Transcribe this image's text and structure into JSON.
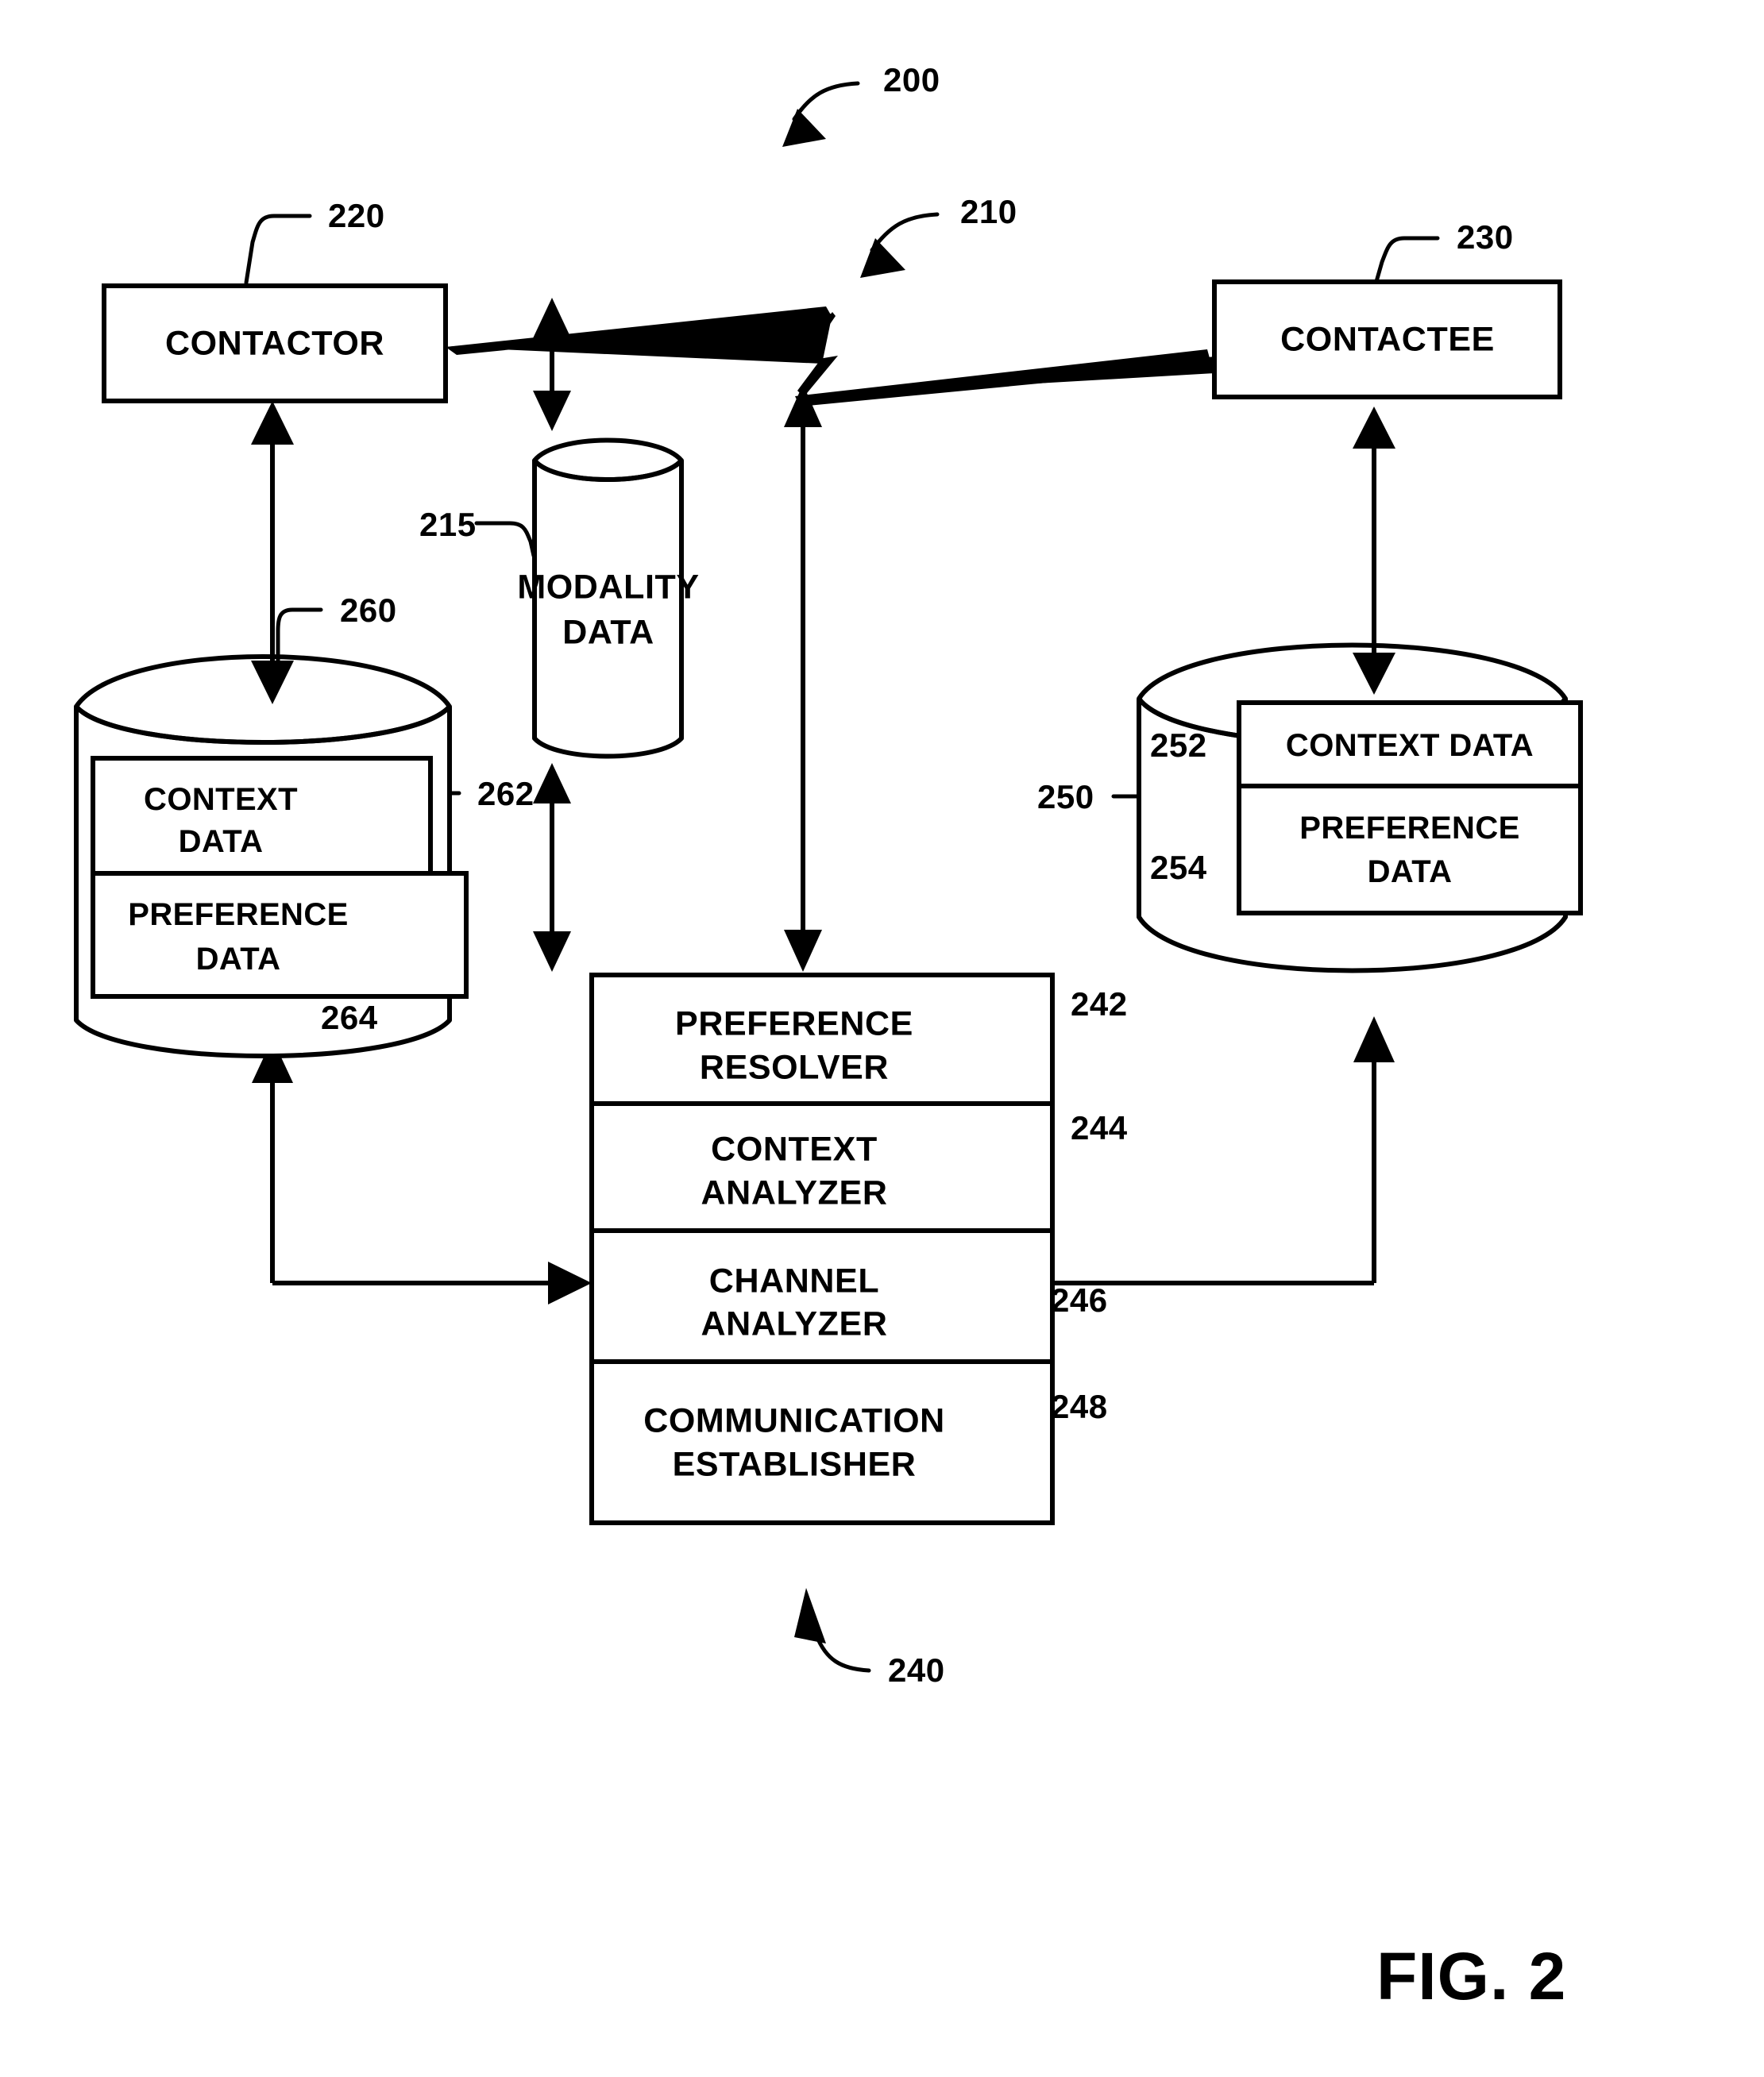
{
  "figure": {
    "caption": "FIG. 2",
    "system_ref": "200"
  },
  "nodes": {
    "contactor": {
      "label": "CONTACTOR",
      "ref": "220"
    },
    "contactee": {
      "label": "CONTACTEE",
      "ref": "230"
    },
    "link": {
      "ref": "210",
      "icon": "lightning-bolt-icon"
    },
    "modality_store": {
      "label_line1": "MODALITY",
      "label_line2": "DATA",
      "ref": "215"
    },
    "contactor_store": {
      "ref": "260",
      "context": {
        "label_line1": "CONTEXT",
        "label_line2": "DATA",
        "ref": "262"
      },
      "preference": {
        "label_line1": "PREFERENCE",
        "label_line2": "DATA",
        "ref": "264"
      }
    },
    "contactee_store": {
      "ref": "250",
      "context": {
        "label": "CONTEXT DATA",
        "ref": "252"
      },
      "preference": {
        "label_line1": "PREFERENCE",
        "label_line2": "DATA",
        "ref": "254"
      }
    },
    "engine": {
      "ref": "240",
      "modules": [
        {
          "label_line1": "PREFERENCE",
          "label_line2": "RESOLVER",
          "ref": "242"
        },
        {
          "label_line1": "CONTEXT",
          "label_line2": "ANALYZER",
          "ref": "244"
        },
        {
          "label_line1": "CHANNEL",
          "label_line2": "ANALYZER",
          "ref": "246"
        },
        {
          "label_line1": "COMMUNICATION",
          "label_line2": "ESTABLISHER",
          "ref": "248"
        }
      ]
    }
  },
  "colors": {
    "ink": "#000000",
    "paper": "#ffffff"
  }
}
